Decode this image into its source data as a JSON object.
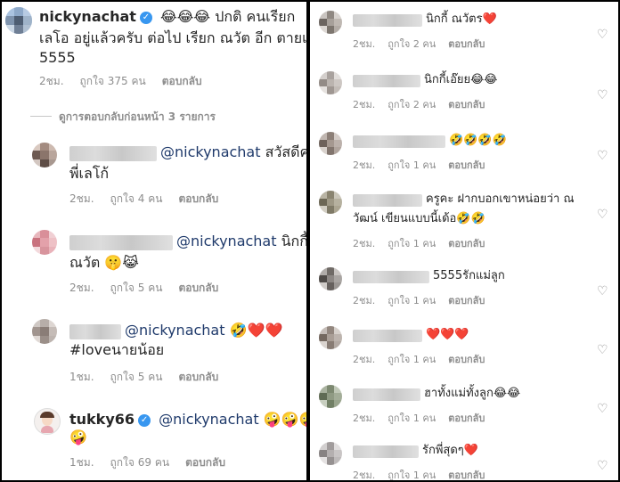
{
  "left": {
    "main_comment": {
      "username": "nickynachat",
      "text_line1": "😂😂😂 ปกติ คนเรียก",
      "text_line2": "เลโอ อยู่แล้วครับ ต่อไป เรียก ณวัต อีก ตายเลย",
      "text_line3": "5555",
      "time": "2ชม.",
      "likes": "ถูกใจ 375 คน",
      "reply": "ตอบกลับ"
    },
    "view_replies": "ดูการตอบกลับก่อนหน้า 3 รายการ",
    "replies": [
      {
        "mention": "@nickynachat",
        "text1": "สวัสดีค่ะ",
        "text2": "พี่เลโก้",
        "time": "2ชม.",
        "likes": "ถูกใจ 4 คน",
        "reply": "ตอบกลับ"
      },
      {
        "mention": "@nickynachat",
        "text1": "นิกกี้",
        "text2": "ณวัต 🤫😹",
        "time": "2ชม.",
        "likes": "ถูกใจ 5 คน",
        "reply": "ตอบกลับ"
      },
      {
        "mention": "@nickynachat",
        "text1": "🤣❤️❤️",
        "text2": "#loveนายน้อย",
        "time": "1ชม.",
        "likes": "ถูกใจ 5 คน",
        "reply": "ตอบกลับ"
      },
      {
        "username": "tukky66",
        "mention": "@nickynachat",
        "text1": "🤪🤪🤪",
        "text2": "🤪",
        "time": "1ชม.",
        "likes": "ถูกใจ 69 คน",
        "reply": "ตอบกลับ"
      }
    ]
  },
  "right": {
    "comments": [
      {
        "text1": "นิกกี้ ณวัตร❤️",
        "text2": "",
        "time": "2ชม.",
        "likes": "ถูกใจ 2 คน",
        "reply": "ตอบกลับ"
      },
      {
        "text1": "นิกกี้เอ๊ยย😂😂",
        "text2": "",
        "time": "2ชม.",
        "likes": "ถูกใจ 2 คน",
        "reply": "ตอบกลับ"
      },
      {
        "text1": "🤣🤣🤣🤣",
        "text2": "",
        "time": "2ชม.",
        "likes": "ถูกใจ 1 คน",
        "reply": "ตอบกลับ"
      },
      {
        "text1": "ครูคะ ฝากบอกเขาหน่อยว่า ณ",
        "text2": "วัฒน์ เขียนแบบนี้เด้อ🤣🤣",
        "time": "2ชม.",
        "likes": "ถูกใจ 1 คน",
        "reply": "ตอบกลับ"
      },
      {
        "text1": "5555รักแม่ลูก",
        "text2": "",
        "time": "2ชม.",
        "likes": "ถูกใจ 1 คน",
        "reply": "ตอบกลับ"
      },
      {
        "text1": "❤️❤️❤️",
        "text2": "",
        "time": "2ชม.",
        "likes": "ถูกใจ 1 คน",
        "reply": "ตอบกลับ"
      },
      {
        "text1": "ฮาทั้งแม่ทั้งลูก😂😂",
        "text2": "",
        "time": "2ชม.",
        "likes": "ถูกใจ 1 คน",
        "reply": "ตอบกลับ"
      },
      {
        "text1": "รักพี่สุดๆ❤️",
        "text2": "",
        "time": "2ชม.",
        "likes": "ถูกใจ 1 คน",
        "reply": "ตอบกลับ"
      }
    ]
  },
  "icons": {
    "heart": "heart-outline-icon",
    "verified": "verified-badge-icon"
  },
  "colors": {
    "verified": "#3897f0",
    "meta": "#8e8e8e",
    "text": "#262626"
  }
}
